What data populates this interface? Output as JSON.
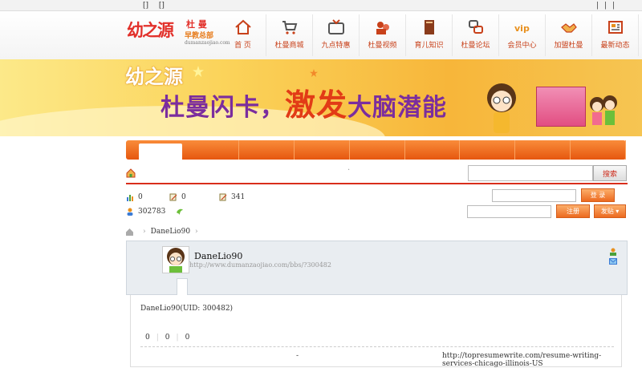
{
  "topbar": {
    "left": [
      "[]",
      "[]"
    ],
    "right": "| | |"
  },
  "logo": {
    "main": "幼之源",
    "sub1": "杜 曼",
    "sub2": "早教总部",
    "url": "dumanzaojiao.com"
  },
  "nav": [
    {
      "label": "首 页",
      "icon": "home-icon"
    },
    {
      "label": "杜曼商城",
      "icon": "cart-icon"
    },
    {
      "label": "九点特惠",
      "icon": "tv-icon"
    },
    {
      "label": "杜曼视频",
      "icon": "video-icon"
    },
    {
      "label": "育儿知识",
      "icon": "book-icon"
    },
    {
      "label": "杜曼论坛",
      "icon": "forum-icon"
    },
    {
      "label": "会员中心",
      "icon": "vip-icon"
    },
    {
      "label": "加盟杜曼",
      "icon": "handshake-icon"
    },
    {
      "label": "最新动态",
      "icon": "news-icon"
    }
  ],
  "banner": {
    "logo": "幼之源",
    "s1": "杜曼闪卡，",
    "s2": "激发",
    "s3": "大脑潜能"
  },
  "search": {
    "button": "搜索",
    "dot": "."
  },
  "stats": {
    "s1": "0",
    "s2": "0",
    "s3": "341",
    "s4": "302783"
  },
  "login": {
    "login_btn": "登 录",
    "register_btn": "注册",
    "post_btn": "发贴 ▾"
  },
  "crumbs": {
    "item": "DaneLio90"
  },
  "profile": {
    "name": "DaneLio90",
    "url": "http://www.dumanzaojiao.com/bbs/?300482"
  },
  "content": {
    "uid": "DaneLio90(UID: 300482)",
    "counts": [
      "0",
      "0",
      "0"
    ],
    "dash": "-",
    "link": "http://topresumewrite.com/resume-writing-services-chicago-illinois-US"
  },
  "colors": {
    "accent": "#ec6a20",
    "brand_red": "#d92e1c"
  }
}
